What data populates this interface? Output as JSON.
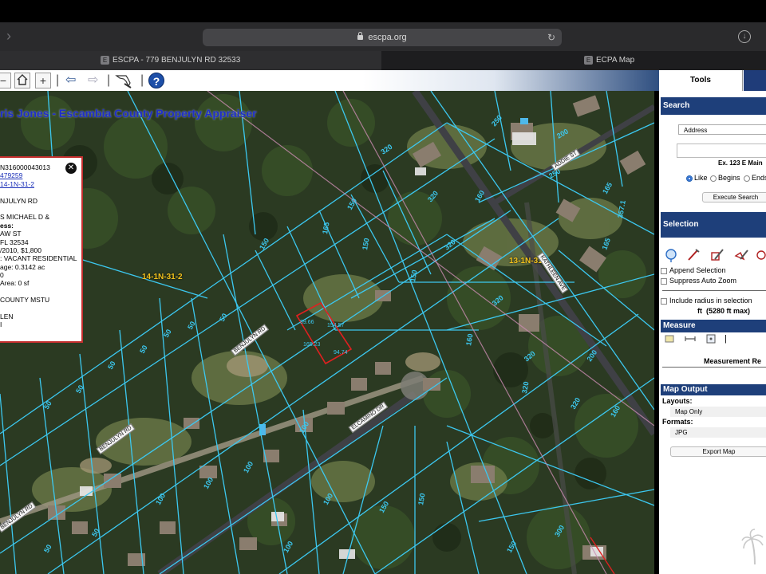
{
  "browser": {
    "url": "escpa.org",
    "tabs": [
      {
        "label": "ESCPA - 779 BENJULYN RD 32533",
        "favicon": "E"
      },
      {
        "label": "ECPA Map",
        "favicon": "E"
      }
    ]
  },
  "map": {
    "title": "ris Jones - Escambia County Property Appraiser",
    "zone_labels": [
      "14-1N-31-2",
      "13-1N-31"
    ],
    "road_labels": [
      "BENJULYN RD",
      "BENJULYN RD",
      "ELCAMINO DR",
      "ADDIE ST",
      "BENJULYN RD",
      "KATHLEEN AVE"
    ],
    "popup": {
      "lines": [
        "N316000043013",
        "479259",
        "14-1N-31-2",
        "",
        "NJULYN RD",
        "",
        "S MICHAEL D &",
        "ess:",
        "AW ST",
        "FL 32534",
        "/2010, $1,800",
        ": VACANT RESIDENTIAL",
        "age: 0.3142 ac",
        "0",
        "Area: 0 sf",
        "",
        "COUNTY MSTU",
        "",
        "LEN",
        "I"
      ],
      "link_lines": [
        1,
        2
      ]
    }
  },
  "panel": {
    "tabs": [
      "Tools"
    ],
    "search": {
      "header": "Search",
      "type_value": "Address",
      "input_value": "",
      "example": "Ex. 123 E Main",
      "match_options": [
        "Like",
        "Begins",
        "Ends"
      ],
      "selected_match": "Like",
      "execute_label": "Execute Search"
    },
    "selection": {
      "header": "Selection",
      "append_label": "Append Selection",
      "suppress_label": "Suppress Auto Zoom",
      "radius_label": "Include radius in selection",
      "radius_unit": "ft",
      "radius_max": "(5280 ft max)"
    },
    "measure": {
      "header": "Measure",
      "results_label": "Measurement Re"
    },
    "output": {
      "header": "Map Output",
      "layouts_label": "Layouts:",
      "layout_value": "Map Only",
      "formats_label": "Formats:",
      "format_value": "JPG",
      "export_label": "Export Map"
    }
  },
  "colors": {
    "panel_header": "#1e3f7a",
    "parcel_line": "#3cc8f0",
    "selected_parcel": "#e02020",
    "zone_label": "#f2c21c",
    "title_text": "#1f2fc8"
  }
}
